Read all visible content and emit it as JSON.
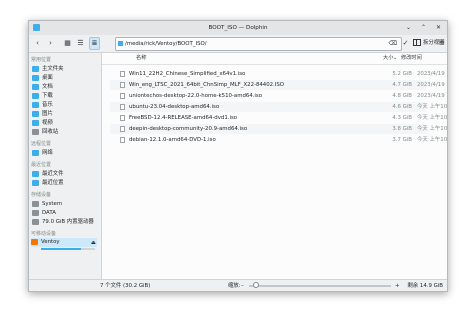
{
  "window": {
    "title": "BOOT_ISO — Dolphin"
  },
  "toolbar": {
    "back": "‹",
    "forward": "›",
    "path": "/media/rick/Ventoy/BOOT_ISO/",
    "split_label": "拆分视图",
    "menu": "≡"
  },
  "sidebar": {
    "places_header": "常用位置",
    "places": [
      "主文件夹",
      "桌面",
      "文档",
      "下载",
      "音乐",
      "图片",
      "视频",
      "回收站"
    ],
    "remote_header": "远程位置",
    "remote": [
      "网络"
    ],
    "recent_header": "最近位置",
    "recent": [
      "最近文件",
      "最近位置"
    ],
    "devices_header": "存储设备",
    "devices": [
      "System",
      "DATA",
      "79.0 GiB 内置驱动器"
    ],
    "removable_header": "可移动设备",
    "removable": [
      "Ventoy"
    ],
    "device_usage": 0.74
  },
  "columns": {
    "name": "名称",
    "size": "大小",
    "date": "修改时间",
    "sort": "⌄"
  },
  "files": [
    {
      "name": "Win11_22H2_Chinese_Simplified_x64v1.iso",
      "size": "5.2 GiB",
      "date": "2023/4/19 下午7:50"
    },
    {
      "name": "Win_eng_LTSC_2021_64bit_ChnSimp_MLF_X22-84402.ISO",
      "size": "4.7 GiB",
      "date": "2023/4/19 下午7:52"
    },
    {
      "name": "uniontechos-desktop-22.0-home-k510-amd64.iso",
      "size": "4.8 GiB",
      "date": "2023/4/19 下午7:57"
    },
    {
      "name": "ubuntu-23.04-desktop-amd64.iso",
      "size": "4.6 GiB",
      "date": "今天 上午10:19"
    },
    {
      "name": "FreeBSD-12.4-RELEASE-amd64-dvd1.iso",
      "size": "4.3 GiB",
      "date": "今天 上午10:19"
    },
    {
      "name": "deepin-desktop-community-20.9-amd64.iso",
      "size": "3.8 GiB",
      "date": "今天 上午10:20"
    },
    {
      "name": "debian-12.1.0-amd64-DVD-1.iso",
      "size": "3.7 GiB",
      "date": "今天 上午10:21"
    }
  ],
  "status": {
    "summary": "7 个文件 (30.2 GiB)",
    "zoom_label": "缩放:",
    "zoom_level": 0.03,
    "free_space": "剩余 14.9 GiB"
  },
  "colors": {
    "accent": "#3daee9",
    "selection": "#cde8f8",
    "device": "#f67400"
  }
}
